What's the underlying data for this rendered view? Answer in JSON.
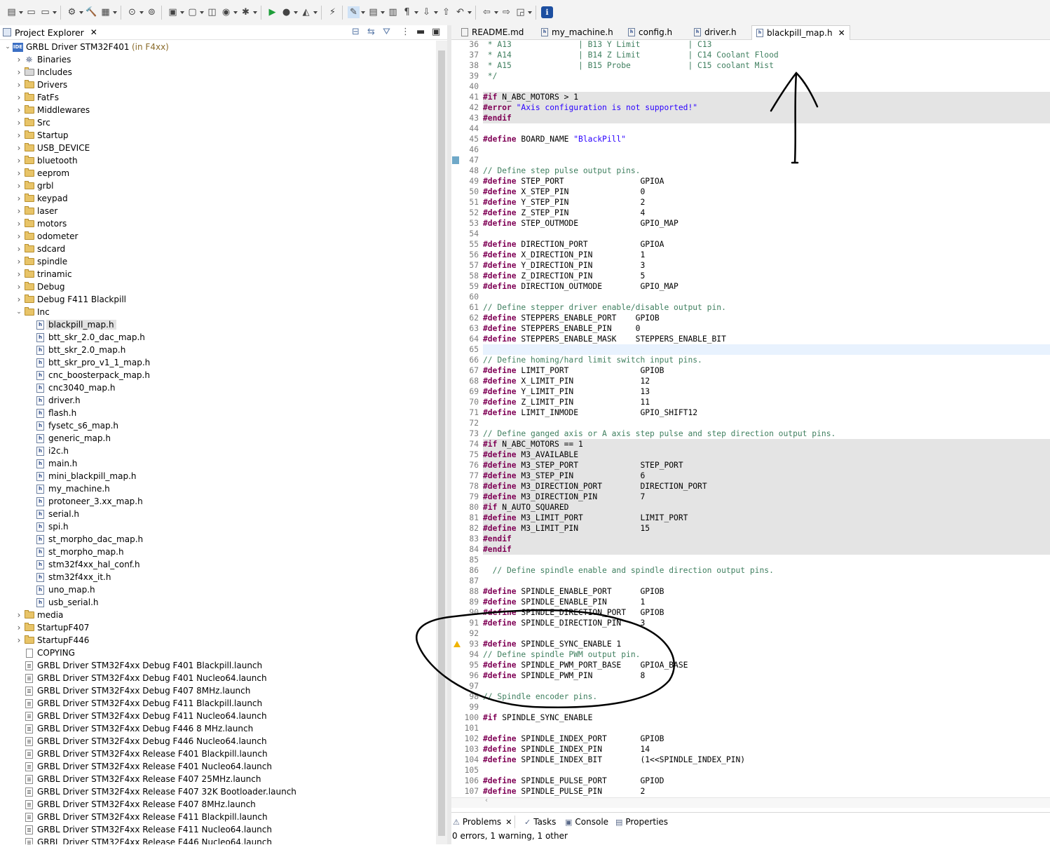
{
  "toolbar": {
    "icons": [
      "new-icon",
      "save-icon",
      "save-all-icon",
      "build-config-icon",
      "build-icon",
      "binary-icon",
      "debug-icon",
      "run-external-icon",
      "new-project-icon",
      "new-folder-icon",
      "new-class-icon",
      "new-source-icon",
      "debug-run-icon",
      "run-icon",
      "profile-icon",
      "open-type-icon",
      "search-icon",
      "toggle-highlight-icon",
      "toggle-mark-icon",
      "toggle-block-icon",
      "show-whitespace-icon",
      "next-annotation-icon",
      "prev-annotation-icon",
      "last-edit-icon",
      "back-icon",
      "forward-icon",
      "open-perspective-icon",
      "info-icon"
    ]
  },
  "project_explorer": {
    "title": "Project Explorer",
    "project": {
      "name": "GRBL Driver STM32F401",
      "suffix": "(in F4xx)",
      "badge": "IDE"
    },
    "folders_top": [
      "Binaries",
      "Includes",
      "Drivers",
      "FatFs",
      "Middlewares",
      "Src",
      "Startup",
      "USB_DEVICE",
      "bluetooth",
      "eeprom",
      "grbl",
      "keypad",
      "laser",
      "motors",
      "odometer",
      "sdcard",
      "spindle",
      "trinamic",
      "Debug",
      "Debug F411 Blackpill",
      "Inc"
    ],
    "inc_files": [
      "blackpill_map.h",
      "btt_skr_2.0_dac_map.h",
      "btt_skr_2.0_map.h",
      "btt_skr_pro_v1_1_map.h",
      "cnc_boosterpack_map.h",
      "cnc3040_map.h",
      "driver.h",
      "flash.h",
      "fysetc_s6_map.h",
      "generic_map.h",
      "i2c.h",
      "main.h",
      "mini_blackpill_map.h",
      "my_machine.h",
      "protoneer_3.xx_map.h",
      "serial.h",
      "spi.h",
      "st_morpho_dac_map.h",
      "st_morpho_map.h",
      "stm32f4xx_hal_conf.h",
      "stm32f4xx_it.h",
      "uno_map.h",
      "usb_serial.h"
    ],
    "folders_bottom": [
      "media",
      "StartupF407",
      "StartupF446"
    ],
    "files_bottom": [
      "COPYING",
      "GRBL Driver STM32F4xx Debug F401 Blackpill.launch",
      "GRBL Driver STM32F4xx Debug F401 Nucleo64.launch",
      "GRBL Driver STM32F4xx Debug F407 8MHz.launch",
      "GRBL Driver STM32F4xx Debug F411 Blackpill.launch",
      "GRBL Driver STM32F4xx Debug F411 Nucleo64.launch",
      "GRBL Driver STM32F4xx Debug F446 8 MHz.launch",
      "GRBL Driver STM32F4xx Debug F446 Nucleo64.launch",
      "GRBL Driver STM32F4xx Release F401 Blackpill.launch",
      "GRBL Driver STM32F4xx Release F401 Nucleo64.launch",
      "GRBL Driver STM32F4xx Release F407 25MHz.launch",
      "GRBL Driver STM32F4xx Release F407 32K Bootloader.launch",
      "GRBL Driver STM32F4xx Release F407 8MHz.launch",
      "GRBL Driver STM32F4xx Release F411 Blackpill.launch",
      "GRBL Driver STM32F4xx Release F411 Nucleo64.launch",
      "GRBL Driver STM32F4xx Release F446 Nucleo64.launch"
    ],
    "selected_file": "blackpill_map.h"
  },
  "editor_tabs": [
    {
      "label": "README.md",
      "active": false
    },
    {
      "label": "my_machine.h",
      "active": false
    },
    {
      "label": "config.h",
      "active": false
    },
    {
      "label": "driver.h",
      "active": false
    },
    {
      "label": "blackpill_map.h",
      "active": true
    }
  ],
  "code": [
    {
      "n": "36",
      "t": [
        [
          "cm",
          " * A13              | B13 Y Limit          | C13"
        ]
      ]
    },
    {
      "n": "37",
      "t": [
        [
          "cm",
          " * A14              | B14 Z Limit          | C14 Coolant Flood"
        ]
      ]
    },
    {
      "n": "38",
      "t": [
        [
          "cm",
          " * A15              | B15 Probe            | C15 coolant Mist"
        ]
      ]
    },
    {
      "n": "39",
      "t": [
        [
          "cm",
          " */"
        ]
      ]
    },
    {
      "n": "40",
      "t": []
    },
    {
      "n": "41",
      "t": [
        [
          "pp",
          "#if"
        ],
        [
          "id",
          " N_ABC_MOTORS > 1"
        ]
      ],
      "bg": true
    },
    {
      "n": "42",
      "t": [
        [
          "pp",
          "#error"
        ],
        [
          "id",
          " "
        ],
        [
          "st",
          "\"Axis configuration is not supported!\""
        ]
      ],
      "bg": true
    },
    {
      "n": "43",
      "t": [
        [
          "pp",
          "#endif"
        ]
      ],
      "bg": true
    },
    {
      "n": "44",
      "t": []
    },
    {
      "n": "45",
      "t": [
        [
          "pp",
          "#define"
        ],
        [
          "id",
          " BOARD_NAME "
        ],
        [
          "st",
          "\"BlackPill\""
        ]
      ]
    },
    {
      "n": "46",
      "t": []
    },
    {
      "n": "47",
      "t": []
    },
    {
      "n": "48",
      "t": [
        [
          "cm",
          "// Define step pulse output pins."
        ]
      ]
    },
    {
      "n": "49",
      "t": [
        [
          "pp",
          "#define"
        ],
        [
          "id",
          " STEP_PORT                GPIOA"
        ]
      ]
    },
    {
      "n": "50",
      "t": [
        [
          "pp",
          "#define"
        ],
        [
          "id",
          " X_STEP_PIN               0"
        ]
      ]
    },
    {
      "n": "51",
      "t": [
        [
          "pp",
          "#define"
        ],
        [
          "id",
          " Y_STEP_PIN               2"
        ]
      ]
    },
    {
      "n": "52",
      "t": [
        [
          "pp",
          "#define"
        ],
        [
          "id",
          " Z_STEP_PIN               4"
        ]
      ]
    },
    {
      "n": "53",
      "t": [
        [
          "pp",
          "#define"
        ],
        [
          "id",
          " STEP_OUTMODE             GPIO_MAP"
        ]
      ]
    },
    {
      "n": "54",
      "t": []
    },
    {
      "n": "55",
      "t": [
        [
          "pp",
          "#define"
        ],
        [
          "id",
          " DIRECTION_PORT           GPIOA"
        ]
      ]
    },
    {
      "n": "56",
      "t": [
        [
          "pp",
          "#define"
        ],
        [
          "id",
          " X_DIRECTION_PIN          1"
        ]
      ]
    },
    {
      "n": "57",
      "t": [
        [
          "pp",
          "#define"
        ],
        [
          "id",
          " Y_DIRECTION_PIN          3"
        ]
      ]
    },
    {
      "n": "58",
      "t": [
        [
          "pp",
          "#define"
        ],
        [
          "id",
          " Z_DIRECTION_PIN          5"
        ]
      ]
    },
    {
      "n": "59",
      "t": [
        [
          "pp",
          "#define"
        ],
        [
          "id",
          " DIRECTION_OUTMODE        GPIO_MAP"
        ]
      ]
    },
    {
      "n": "60",
      "t": []
    },
    {
      "n": "61",
      "t": [
        [
          "cm",
          "// Define stepper driver enable/disable output pin."
        ]
      ]
    },
    {
      "n": "62",
      "t": [
        [
          "pp",
          "#define"
        ],
        [
          "id",
          " STEPPERS_ENABLE_PORT    GPIOB"
        ]
      ]
    },
    {
      "n": "63",
      "t": [
        [
          "pp",
          "#define"
        ],
        [
          "id",
          " STEPPERS_ENABLE_PIN     0"
        ]
      ]
    },
    {
      "n": "64",
      "t": [
        [
          "pp",
          "#define"
        ],
        [
          "id",
          " STEPPERS_ENABLE_MASK    STEPPERS_ENABLE_BIT"
        ]
      ]
    },
    {
      "n": "65",
      "t": [],
      "cur": true
    },
    {
      "n": "66",
      "t": [
        [
          "cm",
          "// Define homing/hard limit switch input pins."
        ]
      ]
    },
    {
      "n": "67",
      "t": [
        [
          "pp",
          "#define"
        ],
        [
          "id",
          " LIMIT_PORT               GPIOB"
        ]
      ]
    },
    {
      "n": "68",
      "t": [
        [
          "pp",
          "#define"
        ],
        [
          "id",
          " X_LIMIT_PIN              12"
        ]
      ]
    },
    {
      "n": "69",
      "t": [
        [
          "pp",
          "#define"
        ],
        [
          "id",
          " Y_LIMIT_PIN              13"
        ]
      ]
    },
    {
      "n": "70",
      "t": [
        [
          "pp",
          "#define"
        ],
        [
          "id",
          " Z_LIMIT_PIN              11"
        ]
      ]
    },
    {
      "n": "71",
      "t": [
        [
          "pp",
          "#define"
        ],
        [
          "id",
          " LIMIT_INMODE             GPIO_SHIFT12"
        ]
      ]
    },
    {
      "n": "72",
      "t": []
    },
    {
      "n": "73",
      "t": [
        [
          "cm",
          "// Define ganged axis or A axis step pulse and step direction output pins."
        ]
      ]
    },
    {
      "n": "74",
      "t": [
        [
          "pp",
          "#if"
        ],
        [
          "id",
          " N_ABC_MOTORS == 1"
        ]
      ],
      "bg": true
    },
    {
      "n": "75",
      "t": [
        [
          "pp",
          "#define"
        ],
        [
          "id",
          " M3_AVAILABLE"
        ]
      ],
      "bg": true
    },
    {
      "n": "76",
      "t": [
        [
          "pp",
          "#define"
        ],
        [
          "id",
          " M3_STEP_PORT             STEP_PORT"
        ]
      ],
      "bg": true
    },
    {
      "n": "77",
      "t": [
        [
          "pp",
          "#define"
        ],
        [
          "id",
          " M3_STEP_PIN              6"
        ]
      ],
      "bg": true
    },
    {
      "n": "78",
      "t": [
        [
          "pp",
          "#define"
        ],
        [
          "id",
          " M3_DIRECTION_PORT        DIRECTION_PORT"
        ]
      ],
      "bg": true
    },
    {
      "n": "79",
      "t": [
        [
          "pp",
          "#define"
        ],
        [
          "id",
          " M3_DIRECTION_PIN         7"
        ]
      ],
      "bg": true
    },
    {
      "n": "80",
      "t": [
        [
          "pp",
          "#if"
        ],
        [
          "id",
          " N_AUTO_SQUARED"
        ]
      ],
      "bg": true
    },
    {
      "n": "81",
      "t": [
        [
          "pp",
          "#define"
        ],
        [
          "id",
          " M3_LIMIT_PORT            LIMIT_PORT"
        ]
      ],
      "bg": true
    },
    {
      "n": "82",
      "t": [
        [
          "pp",
          "#define"
        ],
        [
          "id",
          " M3_LIMIT_PIN             15"
        ]
      ],
      "bg": true
    },
    {
      "n": "83",
      "t": [
        [
          "pp",
          "#endif"
        ]
      ],
      "bg": true
    },
    {
      "n": "84",
      "t": [
        [
          "pp",
          "#endif"
        ]
      ],
      "bg": true
    },
    {
      "n": "85",
      "t": []
    },
    {
      "n": "86",
      "t": [
        [
          "cm",
          "  // Define spindle enable and spindle direction output pins."
        ]
      ]
    },
    {
      "n": "87",
      "t": []
    },
    {
      "n": "88",
      "t": [
        [
          "pp",
          "#define"
        ],
        [
          "id",
          " SPINDLE_ENABLE_PORT      GPIOB"
        ]
      ]
    },
    {
      "n": "89",
      "t": [
        [
          "pp",
          "#define"
        ],
        [
          "id",
          " SPINDLE_ENABLE_PIN       1"
        ]
      ]
    },
    {
      "n": "90",
      "t": [
        [
          "pp",
          "#define"
        ],
        [
          "id",
          " SPINDLE_DIRECTION_PORT   GPIOB"
        ]
      ]
    },
    {
      "n": "91",
      "t": [
        [
          "pp",
          "#define"
        ],
        [
          "id",
          " SPINDLE_DIRECTION_PIN    3"
        ]
      ]
    },
    {
      "n": "92",
      "t": []
    },
    {
      "n": "93",
      "t": [
        [
          "pp",
          "#define"
        ],
        [
          "id",
          " SPINDLE_SYNC_ENABLE 1"
        ]
      ],
      "warn": true
    },
    {
      "n": "94",
      "t": [
        [
          "cm",
          "// Define spindle PWM output pin."
        ]
      ]
    },
    {
      "n": "95",
      "t": [
        [
          "pp",
          "#define"
        ],
        [
          "id",
          " SPINDLE_PWM_PORT_BASE    GPIOA_BASE"
        ]
      ]
    },
    {
      "n": "96",
      "t": [
        [
          "pp",
          "#define"
        ],
        [
          "id",
          " SPINDLE_PWM_PIN          8"
        ]
      ]
    },
    {
      "n": "97",
      "t": []
    },
    {
      "n": "98",
      "t": [
        [
          "cm",
          "// Spindle encoder pins."
        ]
      ]
    },
    {
      "n": "99",
      "t": []
    },
    {
      "n": "100",
      "t": [
        [
          "pp",
          "#if"
        ],
        [
          "id",
          " SPINDLE_SYNC_ENABLE"
        ]
      ]
    },
    {
      "n": "101",
      "t": []
    },
    {
      "n": "102",
      "t": [
        [
          "pp",
          "#define"
        ],
        [
          "id",
          " SPINDLE_INDEX_PORT       GPIOB"
        ]
      ]
    },
    {
      "n": "103",
      "t": [
        [
          "pp",
          "#define"
        ],
        [
          "id",
          " SPINDLE_INDEX_PIN        14"
        ]
      ]
    },
    {
      "n": "104",
      "t": [
        [
          "pp",
          "#define"
        ],
        [
          "id",
          " SPINDLE_INDEX_BIT        (1<<SPINDLE_INDEX_PIN)"
        ]
      ]
    },
    {
      "n": "105",
      "t": []
    },
    {
      "n": "106",
      "t": [
        [
          "pp",
          "#define"
        ],
        [
          "id",
          " SPINDLE_PULSE_PORT       GPIOD"
        ]
      ]
    },
    {
      "n": "107",
      "t": [
        [
          "pp",
          "#define"
        ],
        [
          "id",
          " SPINDLE_PULSE_PIN        2"
        ]
      ]
    }
  ],
  "bottom_tabs": [
    {
      "label": "Problems",
      "active": true
    },
    {
      "label": "Tasks",
      "active": false
    },
    {
      "label": "Console",
      "active": false
    },
    {
      "label": "Properties",
      "active": false
    }
  ],
  "status": "0 errors, 1 warning, 1 other",
  "colors": {
    "preprocessor": "#7f0055",
    "comment": "#3f7f5f",
    "string": "#2a00ff",
    "inactive_bg": "#e4e4e4",
    "warning": "#f0b400"
  }
}
